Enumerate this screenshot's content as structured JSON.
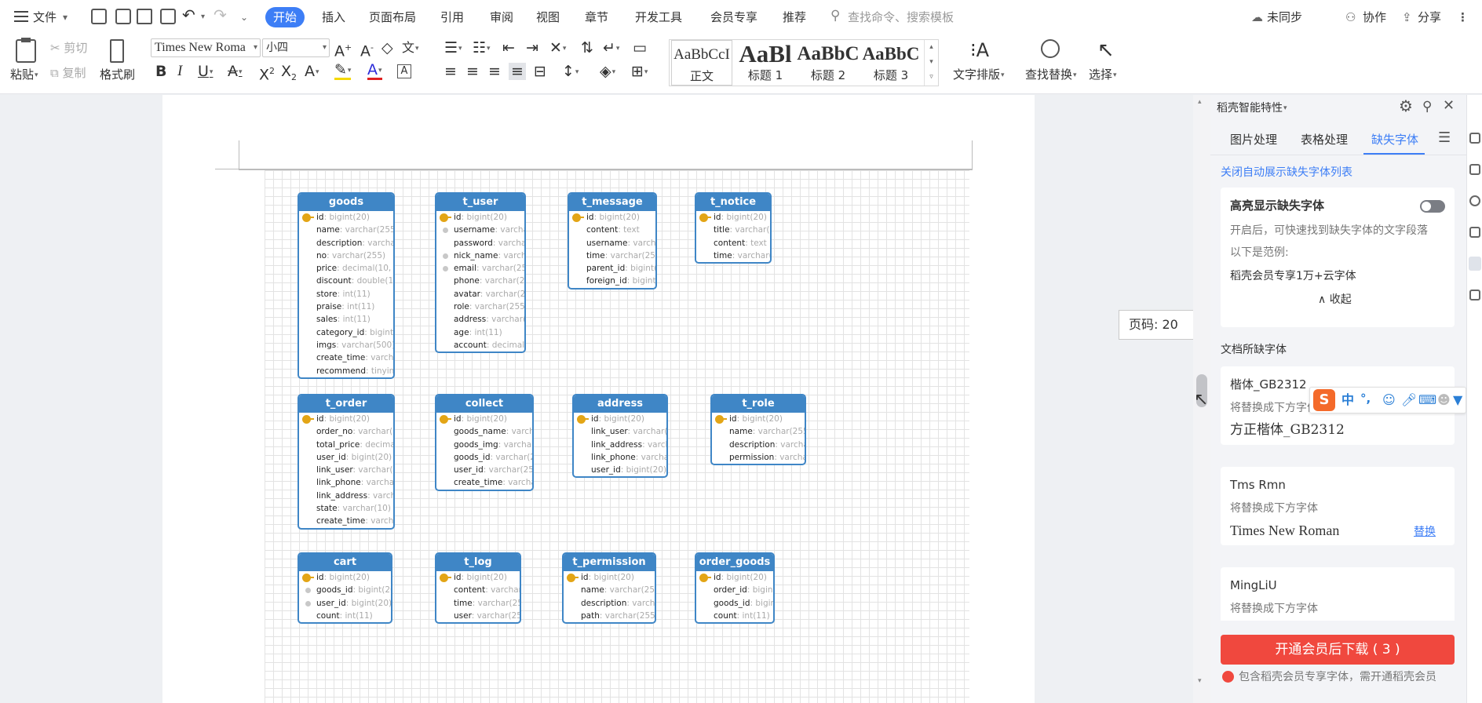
{
  "menubar": {
    "file": "文件",
    "items": [
      "开始",
      "插入",
      "页面布局",
      "引用",
      "审阅",
      "视图",
      "章节",
      "开发工具",
      "会员专享",
      "推荐"
    ],
    "search_placeholder": "查找命令、搜索模板",
    "right": [
      "未同步",
      "协作",
      "分享"
    ]
  },
  "ribbon": {
    "paste": "粘贴",
    "cut": "剪切",
    "copy": "复制",
    "format_painter": "格式刷",
    "font_name": "Times New Roma",
    "font_size": "小四",
    "text_layout": "文字排版",
    "find_replace": "查找替换",
    "select": "选择",
    "styles": [
      {
        "preview": "AaBbCcI",
        "name": "正文"
      },
      {
        "preview": "AaBl",
        "name": "标题 1"
      },
      {
        "preview": "AaBbC",
        "name": "标题 2"
      },
      {
        "preview": "AaBbC",
        "name": "标题 3"
      }
    ]
  },
  "document": {
    "page_number": "页码: 20",
    "tables": [
      {
        "name": "goods",
        "columns": [
          [
            "id",
            "bigint(20)",
            "pk"
          ],
          [
            "name",
            "varchar(255)"
          ],
          [
            "description",
            "varchar(1000)"
          ],
          [
            "no",
            "varchar(255)"
          ],
          [
            "price",
            "decimal(10, 2)"
          ],
          [
            "discount",
            "double(10, 2)"
          ],
          [
            "store",
            "int(11)"
          ],
          [
            "praise",
            "int(11)"
          ],
          [
            "sales",
            "int(11)"
          ],
          [
            "category_id",
            "bigint(20)"
          ],
          [
            "imgs",
            "varchar(500)"
          ],
          [
            "create_time",
            "varchar(255)"
          ],
          [
            "recommend",
            "tinyint(1)"
          ]
        ]
      },
      {
        "name": "t_user",
        "columns": [
          [
            "id",
            "bigint(20)",
            "pk"
          ],
          [
            "username",
            "varchar(255)",
            "fk"
          ],
          [
            "password",
            "varchar(255)"
          ],
          [
            "nick_name",
            "varchar(255)",
            "fk"
          ],
          [
            "email",
            "varchar(255)",
            "fk"
          ],
          [
            "phone",
            "varchar(255)"
          ],
          [
            "avatar",
            "varchar(255)"
          ],
          [
            "role",
            "varchar(255)"
          ],
          [
            "address",
            "varchar(255)"
          ],
          [
            "age",
            "int(11)"
          ],
          [
            "account",
            "decimal(10, 2)"
          ]
        ]
      },
      {
        "name": "t_message",
        "columns": [
          [
            "id",
            "bigint(20)",
            "pk"
          ],
          [
            "content",
            "text"
          ],
          [
            "username",
            "varchar(255)"
          ],
          [
            "time",
            "varchar(255)"
          ],
          [
            "parent_id",
            "bigint(20)"
          ],
          [
            "foreign_id",
            "bigint(20)"
          ]
        ]
      },
      {
        "name": "t_notice",
        "columns": [
          [
            "id",
            "bigint(20)",
            "pk"
          ],
          [
            "title",
            "varchar(255)"
          ],
          [
            "content",
            "text"
          ],
          [
            "time",
            "varchar(255)"
          ]
        ]
      },
      {
        "name": "t_order",
        "columns": [
          [
            "id",
            "bigint(20)",
            "pk"
          ],
          [
            "order_no",
            "varchar(20)"
          ],
          [
            "total_price",
            "decimal(10, 2)"
          ],
          [
            "user_id",
            "bigint(20)"
          ],
          [
            "link_user",
            "varchar(20)"
          ],
          [
            "link_phone",
            "varchar(20)"
          ],
          [
            "link_address",
            "varchar(512)"
          ],
          [
            "state",
            "varchar(10)"
          ],
          [
            "create_time",
            "varchar(20)"
          ]
        ]
      },
      {
        "name": "collect",
        "columns": [
          [
            "id",
            "bigint(20)",
            "pk"
          ],
          [
            "goods_name",
            "varchar(255)"
          ],
          [
            "goods_img",
            "varchar(255)"
          ],
          [
            "goods_id",
            "varchar(255)"
          ],
          [
            "user_id",
            "varchar(255)"
          ],
          [
            "create_time",
            "varchar(255)"
          ]
        ]
      },
      {
        "name": "address",
        "columns": [
          [
            "id",
            "bigint(20)",
            "pk"
          ],
          [
            "link_user",
            "varchar(255)"
          ],
          [
            "link_address",
            "varchar(255)"
          ],
          [
            "link_phone",
            "varchar(255)"
          ],
          [
            "user_id",
            "bigint(20)"
          ]
        ]
      },
      {
        "name": "t_role",
        "columns": [
          [
            "id",
            "bigint(20)",
            "pk"
          ],
          [
            "name",
            "varchar(255)"
          ],
          [
            "description",
            "varchar(255)"
          ],
          [
            "permission",
            "varchar(2000)"
          ]
        ]
      },
      {
        "name": "cart",
        "columns": [
          [
            "id",
            "bigint(20)",
            "pk"
          ],
          [
            "goods_id",
            "bigint(20)",
            "fk"
          ],
          [
            "user_id",
            "bigint(20)",
            "fk"
          ],
          [
            "count",
            "int(11)"
          ]
        ]
      },
      {
        "name": "t_log",
        "columns": [
          [
            "id",
            "bigint(20)",
            "pk"
          ],
          [
            "content",
            "varchar(1000)"
          ],
          [
            "time",
            "varchar(255)"
          ],
          [
            "user",
            "varchar(255)"
          ]
        ]
      },
      {
        "name": "t_permission",
        "columns": [
          [
            "id",
            "bigint(20)",
            "pk"
          ],
          [
            "name",
            "varchar(255)"
          ],
          [
            "description",
            "varchar(255)"
          ],
          [
            "path",
            "varchar(255)"
          ]
        ]
      },
      {
        "name": "order_goods",
        "columns": [
          [
            "id",
            "bigint(20)",
            "pk"
          ],
          [
            "order_id",
            "bigint(20)"
          ],
          [
            "goods_id",
            "bigint(20)"
          ],
          [
            "count",
            "int(11)"
          ]
        ]
      }
    ]
  },
  "panel": {
    "title": "稻壳智能特性",
    "tabs": [
      "图片处理",
      "表格处理",
      "缺失字体"
    ],
    "active_tab": 2,
    "link": "关闭自动展示缺失字体列表",
    "highlight": {
      "title": "高亮显示缺失字体",
      "desc": "开启后，可快速找到缺失字体的文字段落",
      "example_label": "以下是范例:",
      "example": "稻壳会员专享1万+云字体",
      "collapse": "收起"
    },
    "missing_title": "文档所缺字体",
    "fonts": [
      {
        "name": "楷体_GB2312",
        "note": "将替换成下方字体",
        "replacement": "方正楷体_GB2312",
        "action": ""
      },
      {
        "name": "Tms Rmn",
        "note": "将替换成下方字体",
        "replacement": "Times New Roman",
        "action": "替换"
      },
      {
        "name": "MingLiU",
        "note": "将替换成下方字体",
        "replacement": "",
        "action": ""
      }
    ],
    "download_button": "开通会员后下载 ( 3 )",
    "footer": "包含稻壳会员专享字体，需开通稻壳会员"
  },
  "ime": {
    "chars": [
      "中",
      "°,"
    ]
  },
  "colors": {
    "accent": "#3d7ef6",
    "table_header": "#3f86c6",
    "download": "#f0483e"
  }
}
